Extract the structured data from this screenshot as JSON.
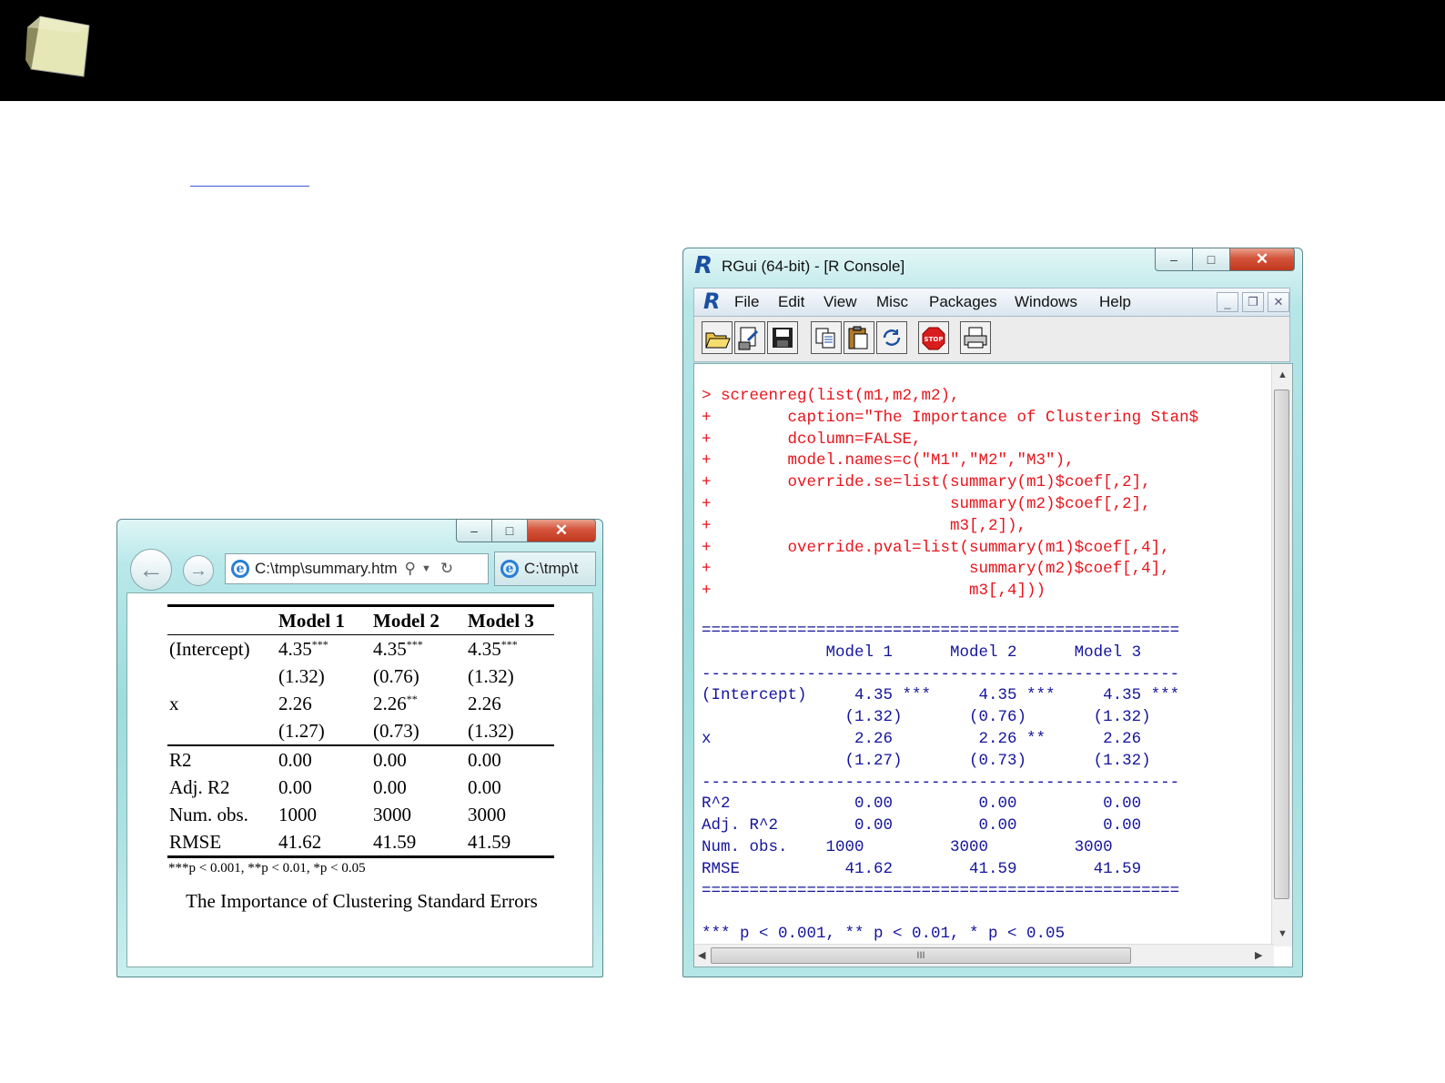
{
  "ie": {
    "address": "C:\\tmp\\summary.htm",
    "tab_label": "C:\\tmp\\t",
    "table": {
      "headers": [
        "",
        "Model 1",
        "Model 2",
        "Model 3"
      ],
      "rows": [
        [
          "(Intercept)",
          "4.35",
          "4.35",
          "4.35"
        ],
        [
          "",
          "(1.32)",
          "(0.76)",
          "(1.32)"
        ],
        [
          "x",
          "2.26",
          "2.26",
          "2.26"
        ],
        [
          "",
          "(1.27)",
          "(0.73)",
          "(1.32)"
        ],
        [
          "R2",
          "0.00",
          "0.00",
          "0.00"
        ],
        [
          "Adj. R2",
          "0.00",
          "0.00",
          "0.00"
        ],
        [
          "Num. obs.",
          "1000",
          "3000",
          "3000"
        ],
        [
          "RMSE",
          "41.62",
          "41.59",
          "41.59"
        ]
      ],
      "stars_intercept": "***",
      "stars_x_m2": "**",
      "note": "***p < 0.001, **p < 0.01, *p < 0.05",
      "caption": "The Importance of Clustering Standard Errors"
    }
  },
  "rgui": {
    "title": "RGui (64-bit) - [R Console]",
    "menu": [
      "File",
      "Edit",
      "View",
      "Misc",
      "Packages",
      "Windows",
      "Help"
    ],
    "code_lines": [
      "> screenreg(list(m1,m2,m2),",
      "+        caption=\"The Importance of Clustering Stan$",
      "+        dcolumn=FALSE,",
      "+        model.names=c(\"M1\",\"M2\",\"M3\"),",
      "+        override.se=list(summary(m1)$coef[,2],",
      "+                         summary(m2)$coef[,2],",
      "+                         m3[,2]),",
      "+        override.pval=list(summary(m1)$coef[,4],",
      "+                           summary(m2)$coef[,4],",
      "+                           m3[,4]))"
    ],
    "output_lines": [
      "==================================================",
      "             Model 1      Model 2      Model 3",
      "--------------------------------------------------",
      "(Intercept)     4.35 ***     4.35 ***     4.35 ***",
      "               (1.32)       (0.76)       (1.32)",
      "x               2.26         2.26 **      2.26",
      "               (1.27)       (0.73)       (1.32)",
      "--------------------------------------------------",
      "R^2             0.00         0.00         0.00",
      "Adj. R^2        0.00         0.00         0.00",
      "Num. obs.    1000         3000         3000",
      "RMSE           41.62        41.59        41.59",
      "==================================================",
      "*** p < 0.001, ** p < 0.01, * p < 0.05"
    ]
  },
  "colors": {
    "console_input": "#e8141c",
    "console_output": "#14149c",
    "header_bg": "#000000"
  }
}
